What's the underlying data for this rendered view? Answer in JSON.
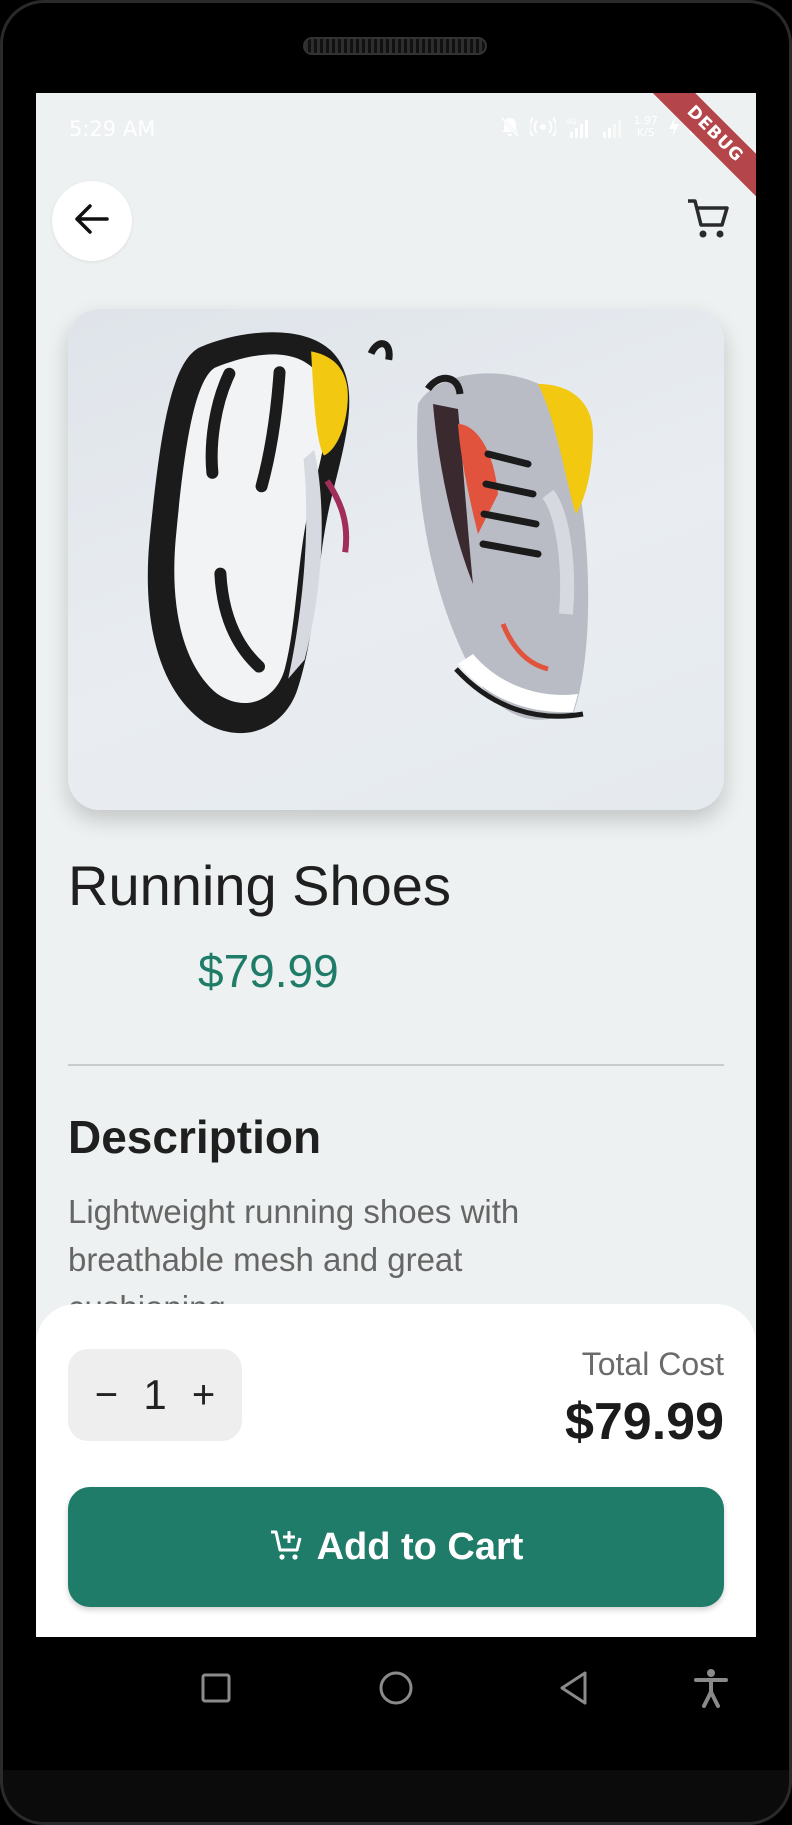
{
  "status_bar": {
    "time": "5:29 AM",
    "speed_value": "1.97",
    "speed_unit": "K/S",
    "icons": [
      "notifications-off-icon",
      "hotspot-icon",
      "signal-4g-icon",
      "signal-icon",
      "charging-icon",
      "battery-icon"
    ]
  },
  "debug_banner": "DEBUG",
  "header": {
    "back_icon": "arrow-left-icon",
    "cart_icon": "shopping-cart-icon"
  },
  "product": {
    "name": "Running Shoes",
    "price": "$79.99",
    "image": "sneakers-pair-image",
    "description_heading": "Description",
    "description": "Lightweight running shoes with breathable mesh and great cushioning."
  },
  "purchase": {
    "decrement_label": "−",
    "quantity": "1",
    "increment_label": "+",
    "total_label": "Total Cost",
    "total_value": "$79.99",
    "add_to_cart_label": "Add to Cart",
    "add_to_cart_icon": "add-shopping-cart-icon"
  },
  "colors": {
    "accent": "#1f7c68",
    "screen_background": "#eef1f1",
    "debug_ribbon": "#b4454a"
  },
  "system_nav": {
    "icons": [
      "recents-square-icon",
      "home-circle-icon",
      "back-triangle-icon",
      "accessibility-icon"
    ]
  }
}
